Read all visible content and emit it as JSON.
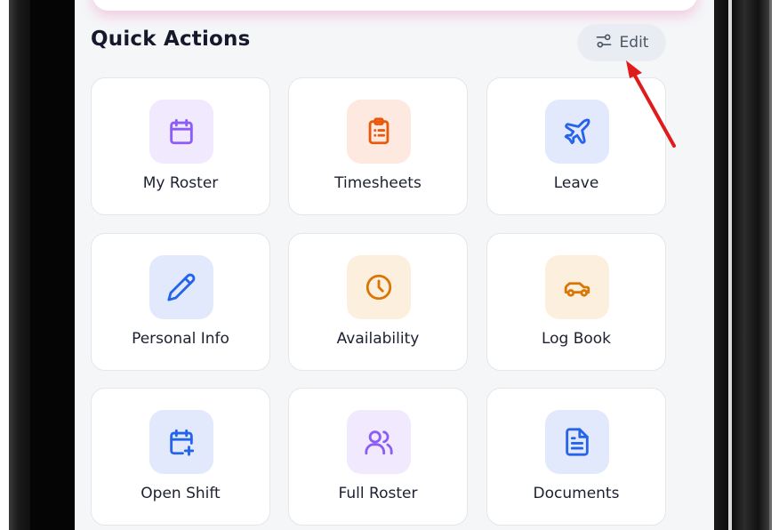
{
  "quick_actions": {
    "title": "Quick Actions",
    "edit_label": "Edit",
    "items": [
      {
        "label": "My Roster",
        "icon": "calendar-icon",
        "color": "#8b5cf6",
        "bg": "#f1e9fe"
      },
      {
        "label": "Timesheets",
        "icon": "clipboard-list-icon",
        "color": "#ea580c",
        "bg": "#fde9df"
      },
      {
        "label": "Leave",
        "icon": "plane-icon",
        "color": "#2563eb",
        "bg": "#e2e9fc"
      },
      {
        "label": "Personal Info",
        "icon": "pencil-icon",
        "color": "#2563eb",
        "bg": "#e2e9fc"
      },
      {
        "label": "Availability",
        "icon": "clock-icon",
        "color": "#d97706",
        "bg": "#fcefdd"
      },
      {
        "label": "Log Book",
        "icon": "car-icon",
        "color": "#d97706",
        "bg": "#fcefdd"
      },
      {
        "label": "Open Shift",
        "icon": "calendar-plus-icon",
        "color": "#2563eb",
        "bg": "#e2e9fc"
      },
      {
        "label": "Full Roster",
        "icon": "users-icon",
        "color": "#8b5cf6",
        "bg": "#f1e9fe"
      },
      {
        "label": "Documents",
        "icon": "document-icon",
        "color": "#2563eb",
        "bg": "#e2e9fc"
      }
    ]
  },
  "annotation": {
    "arrow_color": "#e01b1b"
  }
}
